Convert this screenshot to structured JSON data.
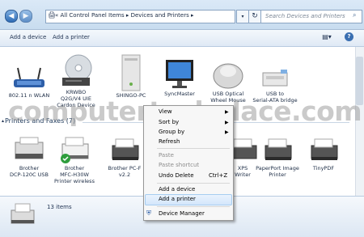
{
  "address": {
    "back_glyph": "◀",
    "forward_glyph": "▶",
    "path": "« All Control Panel Items ▸ Devices and Printers ▸",
    "search_placeholder": "Search Devices and Printers"
  },
  "toolbar": {
    "add_device": "Add a device",
    "add_printer": "Add a printer"
  },
  "devices": [
    {
      "label": "802.11 n WLAN",
      "icon": "wlan-icon"
    },
    {
      "label": "KRWBO\nQ2G/V4 UIE\nCardon Device",
      "icon": "cd-drive-icon"
    },
    {
      "label": "SHINGO-PC",
      "icon": "computer-icon"
    },
    {
      "label": "SyncMaster",
      "icon": "monitor-icon"
    },
    {
      "label": "USB Optical\nWheel Mouse",
      "icon": "mouse-icon"
    },
    {
      "label": "USB to\nSerial-ATA bridge",
      "icon": "usb-drive-icon"
    }
  ],
  "printers_group": {
    "title": "Printers and Faxes (7)"
  },
  "printers": [
    {
      "label": "Brother\nDCP-120C USB"
    },
    {
      "label": "Brother\nMFC-H30W\nPrinter wireless",
      "default": true
    },
    {
      "label": "Brother PC-F\nv2.2"
    },
    {
      "label": "XPS\nWriter"
    },
    {
      "label": "PaperPort Image\nPrinter"
    },
    {
      "label": "TinyPDF"
    }
  ],
  "status": {
    "count": "13 items"
  },
  "context_menu": {
    "view": "View",
    "sort_by": "Sort by",
    "group_by": "Group by",
    "refresh": "Refresh",
    "paste": "Paste",
    "paste_shortcut": "Paste shortcut",
    "undo_delete": "Undo Delete",
    "undo_shortcut": "Ctrl+Z",
    "add_device": "Add a device",
    "add_printer": "Add a printer",
    "device_manager": "Device Manager"
  },
  "watermark": "computertechplace.com"
}
